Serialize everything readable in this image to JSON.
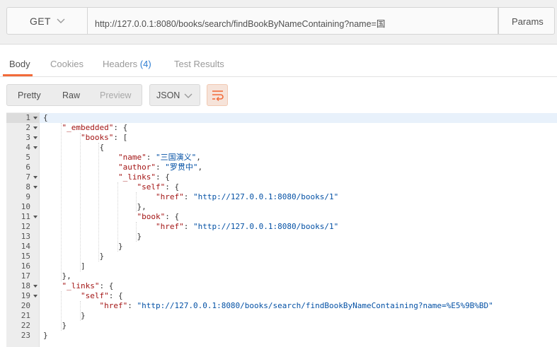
{
  "request": {
    "method": "GET",
    "url": "http://127.0.0.1:8080/books/search/findBookByNameContaining?name=国",
    "params_label": "Params"
  },
  "tabs": [
    {
      "label": "Body",
      "active": true
    },
    {
      "label": "Cookies"
    },
    {
      "label": "Headers",
      "count": "(4)"
    },
    {
      "label": "Test Results"
    }
  ],
  "toolbar": {
    "views": [
      "Pretty",
      "Raw",
      "Preview"
    ],
    "format": "JSON",
    "wrap_icon": "wrap-lines-icon"
  },
  "colors": {
    "accent": "#f26b3a",
    "key": "#a31515",
    "string": "#0451a5",
    "count": "#2d7dd2"
  },
  "editor": {
    "lines": [
      {
        "n": "1",
        "fold": true,
        "text": "{"
      },
      {
        "n": "2",
        "fold": true,
        "key": "\"_embedded\"",
        "rest": ": {"
      },
      {
        "n": "3",
        "fold": true,
        "key": "\"books\"",
        "rest": ": ["
      },
      {
        "n": "4",
        "fold": true,
        "text": "{"
      },
      {
        "n": "5",
        "fold": false,
        "key": "\"name\"",
        "rest": ": ",
        "str": "\"三国演义\"",
        "tail": ","
      },
      {
        "n": "6",
        "fold": false,
        "key": "\"author\"",
        "rest": ": ",
        "str": "\"罗贯中\"",
        "tail": ","
      },
      {
        "n": "7",
        "fold": true,
        "key": "\"_links\"",
        "rest": ": {"
      },
      {
        "n": "8",
        "fold": true,
        "key": "\"self\"",
        "rest": ": {"
      },
      {
        "n": "9",
        "fold": false,
        "key": "\"href\"",
        "rest": ": ",
        "str": "\"http://127.0.0.1:8080/books/1\""
      },
      {
        "n": "10",
        "fold": false,
        "text": "},"
      },
      {
        "n": "11",
        "fold": true,
        "key": "\"book\"",
        "rest": ": {"
      },
      {
        "n": "12",
        "fold": false,
        "key": "\"href\"",
        "rest": ": ",
        "str": "\"http://127.0.0.1:8080/books/1\""
      },
      {
        "n": "13",
        "fold": false,
        "text": "}"
      },
      {
        "n": "14",
        "fold": false,
        "text": "}"
      },
      {
        "n": "15",
        "fold": false,
        "text": "}"
      },
      {
        "n": "16",
        "fold": false,
        "text": "]"
      },
      {
        "n": "17",
        "fold": false,
        "text": "},"
      },
      {
        "n": "18",
        "fold": true,
        "key": "\"_links\"",
        "rest": ": {"
      },
      {
        "n": "19",
        "fold": true,
        "key": "\"self\"",
        "rest": ": {"
      },
      {
        "n": "20",
        "fold": false,
        "key": "\"href\"",
        "rest": ": ",
        "str": "\"http://127.0.0.1:8080/books/search/findBookByNameContaining?name=%E5%9B%BD\""
      },
      {
        "n": "21",
        "fold": false,
        "text": "}"
      },
      {
        "n": "22",
        "fold": false,
        "text": "}"
      },
      {
        "n": "23",
        "fold": false,
        "text": "}"
      }
    ]
  }
}
